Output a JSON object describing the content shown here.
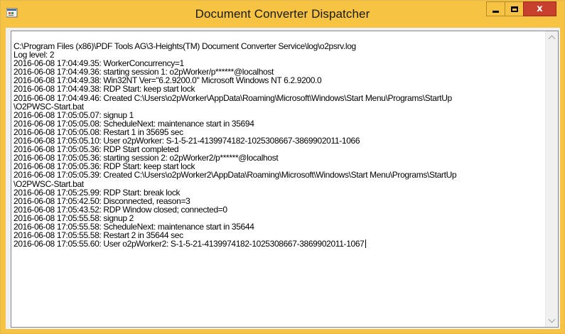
{
  "window": {
    "title": "Document Converter Dispatcher",
    "icon": "application-icon",
    "controls": {
      "minimize": "minimize-icon",
      "maximize": "maximize-icon",
      "close": "close-icon",
      "close_glyph": "x"
    },
    "accent_color": "#f6c342",
    "close_color": "#c7402d"
  },
  "log": {
    "lines": [
      "C:\\Program Files (x86)\\PDF Tools AG\\3-Heights(TM) Document Converter Service\\log\\o2psrv.log",
      "Log level: 2",
      "2016-06-08 17:04:49.35: WorkerConcurrency=1",
      "2016-06-08 17:04:49.36: starting session 1: o2pWorker/p******@localhost",
      "2016-06-08 17:04:49.38: Win32NT  Ver=\"6.2.9200.0\" Microsoft Windows NT 6.2.9200.0",
      "2016-06-08 17:04:49.38: RDP Start: keep start lock",
      "2016-06-08 17:04:49.46: Created C:\\Users\\o2pWorker\\AppData\\Roaming\\Microsoft\\Windows\\Start Menu\\Programs\\StartUp",
      "\\O2PWSC-Start.bat",
      "2016-06-08 17:05:05.07: signup 1",
      "2016-06-08 17:05:05.08: ScheduleNext: maintenance start in 35694",
      "2016-06-08 17:05:05.08: Restart 1 in 35695 sec",
      "2016-06-08 17:05:05.10: User o2pWorker: S-1-5-21-4139974182-1025308667-3869902011-1066",
      "2016-06-08 17:05:05.36: RDP Start completed",
      "2016-06-08 17:05:05.36: starting session 2: o2pWorker2/p******@localhost",
      "2016-06-08 17:05:05.36: RDP Start: keep start lock",
      "2016-06-08 17:05:05.39: Created C:\\Users\\o2pWorker2\\AppData\\Roaming\\Microsoft\\Windows\\Start Menu\\Programs\\StartUp",
      "\\O2PWSC-Start.bat",
      "2016-06-08 17:05:25.99: RDP Start: break lock",
      "2016-06-08 17:05:42.50: Disconnected, reason=3",
      "2016-06-08 17:05:43.52: RDP Window closed; connected=0",
      "2016-06-08 17:05:55.58: signup 2",
      "2016-06-08 17:05:55.58: ScheduleNext: maintenance start in 35644",
      "2016-06-08 17:05:55.58: Restart 2 in 35644 sec",
      "2016-06-08 17:05:55.60: User o2pWorker2: S-1-5-21-4139974182-1025308667-3869902011-1067"
    ]
  },
  "scrollbar": {
    "up_icon": "chevron-up-icon",
    "down_icon": "chevron-down-icon"
  }
}
